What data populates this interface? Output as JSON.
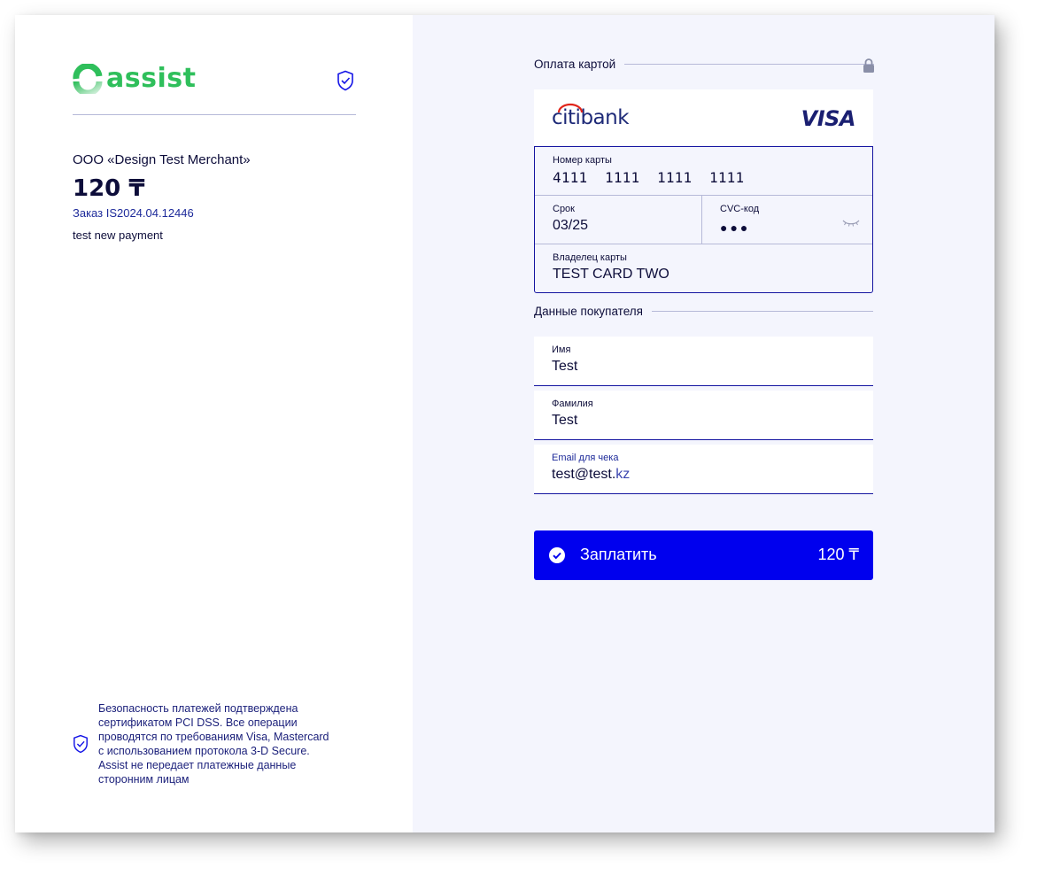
{
  "brand": {
    "logo_text": "assist",
    "accent": "#2fbf5b"
  },
  "left": {
    "merchant": "ООО «Design Test Merchant»",
    "amount": "120 ₸",
    "order": "Заказ IS2024.04.12446",
    "description": "test new payment",
    "security_text": "Безопасность платежей подтверждена\nсертификатом PCI DSS. Все операции\nпроводятся по требованиям Visa, Mastercard\nс использованием протокола 3-D Secure.\nAssist не передает платежные данные\nсторонним лицам"
  },
  "card_section": {
    "title": "Оплата картой",
    "bank": "citibank",
    "network": "VISA",
    "card_number_label": "Номер карты",
    "card_number": "4111  1111  1111  1111",
    "expiry_label": "Срок",
    "expiry": "03/25",
    "cvc_label": "CVC-код",
    "cvc_masked": "●●●",
    "holder_label": "Владелец карты",
    "holder": "TEST CARD TWO"
  },
  "buyer_section": {
    "title": "Данные покупателя",
    "first_name_label": "Имя",
    "first_name": "Test",
    "last_name_label": "Фамилия",
    "last_name": "Test",
    "email_label": "Email для чека",
    "email_main": "test@test.",
    "email_tail": "kz"
  },
  "pay_button": {
    "label": "Заплатить",
    "amount": "120 ₸",
    "color": "#0000ee"
  },
  "colors": {
    "panel_bg": "#f4f5fd",
    "navy": "#0d0d3a",
    "border": "#1414a0"
  }
}
